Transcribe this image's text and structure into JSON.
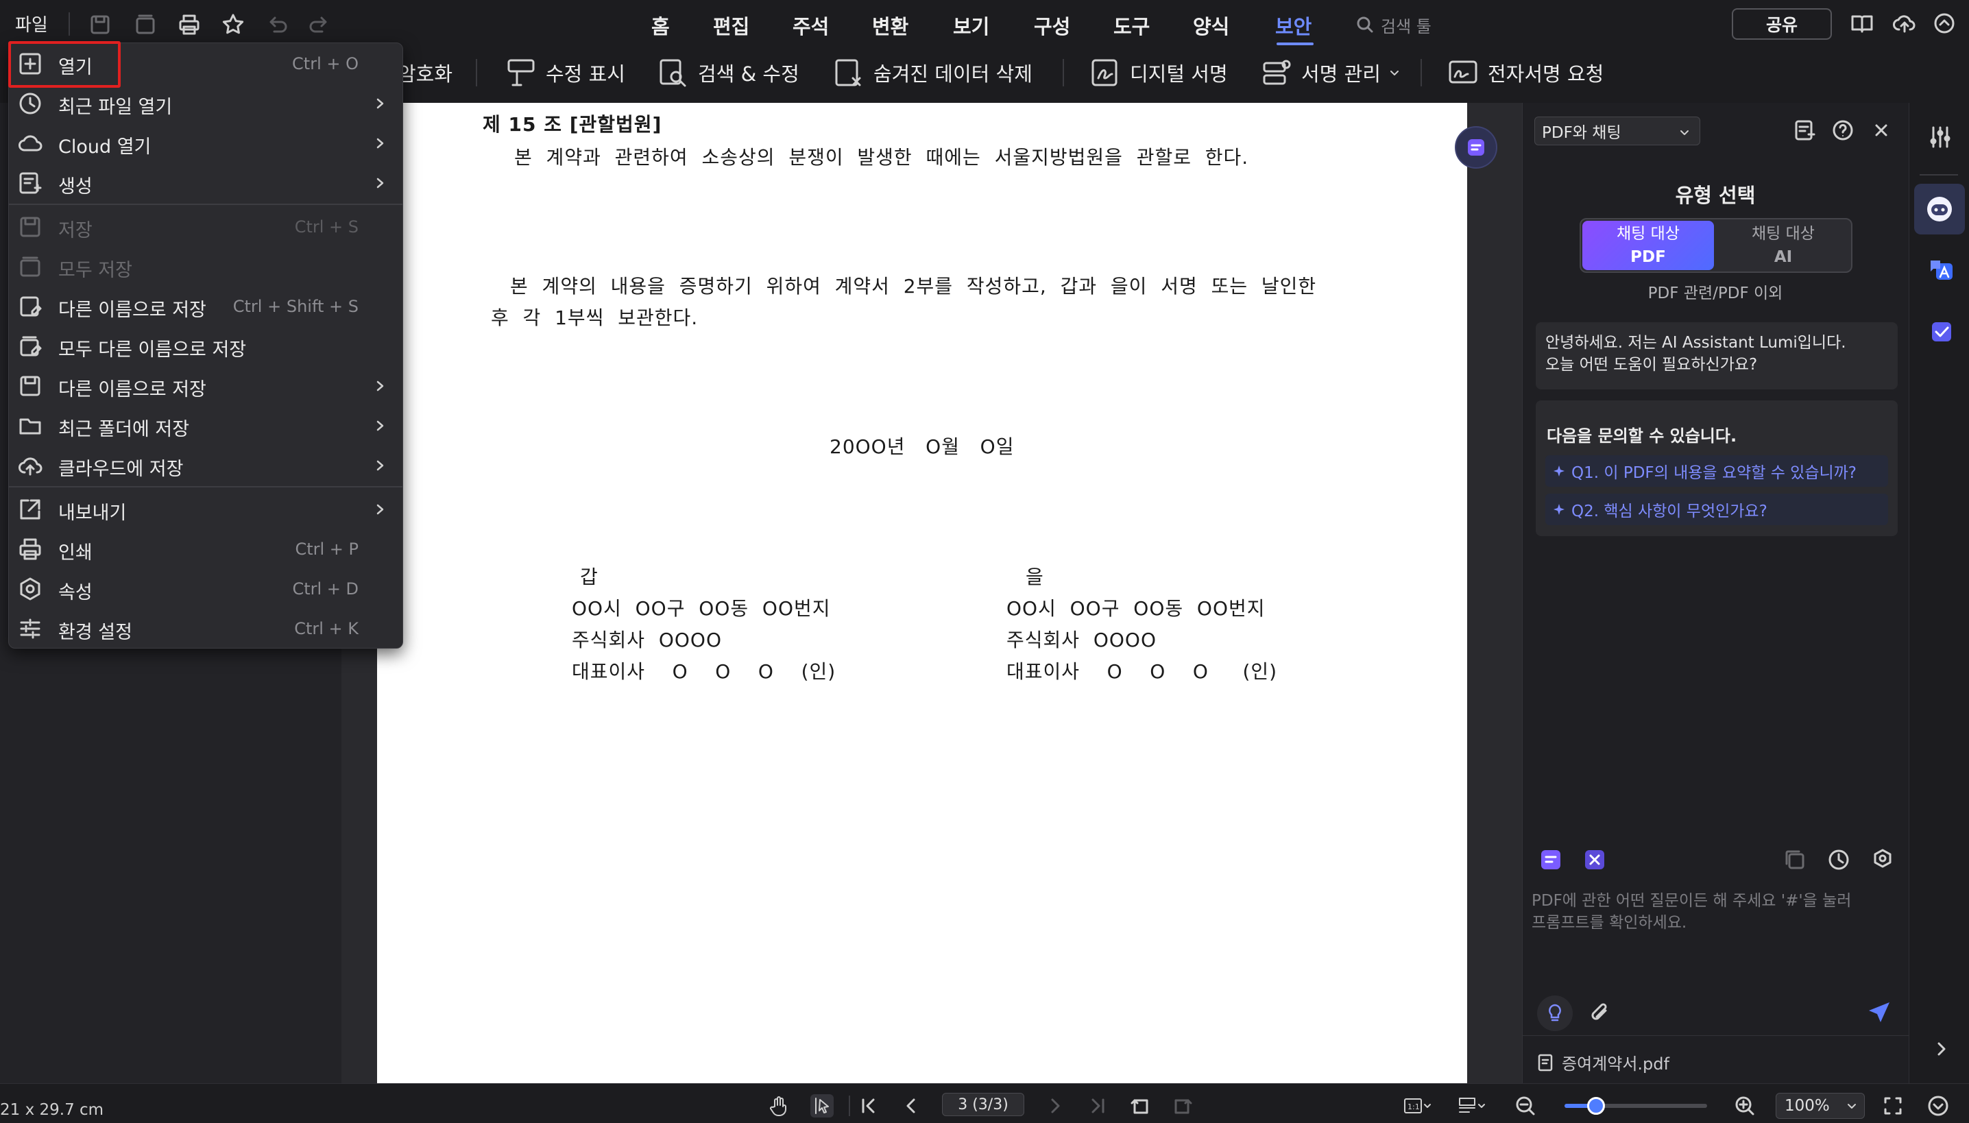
{
  "menubar": {
    "file": "파일",
    "tabs": [
      "홈",
      "편집",
      "주석",
      "변환",
      "보기",
      "구성",
      "도구",
      "양식",
      "보안"
    ],
    "active_tab": "보안",
    "search_placeholder": "검색 툴",
    "share": "공유"
  },
  "toolbar": {
    "items": [
      {
        "label": "암호화",
        "icon": "lock-icon"
      },
      {
        "label": "수정 표시",
        "icon": "redact-mark-icon"
      },
      {
        "label": "검색 & 수정",
        "icon": "search-redact-icon"
      },
      {
        "label": "숨겨진 데이터 삭제",
        "icon": "remove-hidden-data-icon"
      },
      {
        "label": "디지털 서명",
        "icon": "digital-signature-icon"
      },
      {
        "label": "서명 관리",
        "icon": "manage-signature-icon"
      },
      {
        "label": "전자서명 요청",
        "icon": "esign-request-icon"
      }
    ]
  },
  "file_menu": {
    "items": [
      {
        "label": "열기",
        "shortcut": "Ctrl + O",
        "icon": "plus-box-icon",
        "submenu": false,
        "disabled": false,
        "highlighted": true
      },
      {
        "label": "최근 파일 열기",
        "shortcut": "",
        "icon": "clock-icon",
        "submenu": true,
        "disabled": false
      },
      {
        "label": "Cloud 열기",
        "shortcut": "",
        "icon": "cloud-icon",
        "submenu": true,
        "disabled": false
      },
      {
        "label": "생성",
        "shortcut": "",
        "icon": "create-file-icon",
        "submenu": true,
        "disabled": false
      },
      {
        "label": "저장",
        "shortcut": "Ctrl + S",
        "icon": "save-icon",
        "submenu": false,
        "disabled": true
      },
      {
        "label": "모두 저장",
        "shortcut": "",
        "icon": "save-all-icon",
        "submenu": false,
        "disabled": true
      },
      {
        "label": "다른 이름으로 저장",
        "shortcut": "Ctrl + Shift + S",
        "icon": "save-as-icon",
        "submenu": false,
        "disabled": false
      },
      {
        "label": "모두 다른 이름으로 저장",
        "shortcut": "",
        "icon": "save-all-as-icon",
        "submenu": false,
        "disabled": false
      },
      {
        "label": "다른 이름으로 저장",
        "shortcut": "",
        "icon": "save-as-format-icon",
        "submenu": true,
        "disabled": false
      },
      {
        "label": "최근 폴더에 저장",
        "shortcut": "",
        "icon": "folder-icon",
        "submenu": true,
        "disabled": false
      },
      {
        "label": "클라우드에 저장",
        "shortcut": "",
        "icon": "cloud-upload-icon",
        "submenu": true,
        "disabled": false
      },
      {
        "label": "내보내기",
        "shortcut": "",
        "icon": "export-icon",
        "submenu": true,
        "disabled": false
      },
      {
        "label": "인쇄",
        "shortcut": "Ctrl + P",
        "icon": "print-icon",
        "submenu": false,
        "disabled": false
      },
      {
        "label": "속성",
        "shortcut": "Ctrl + D",
        "icon": "properties-icon",
        "submenu": false,
        "disabled": false
      },
      {
        "label": "환경 설정",
        "shortcut": "Ctrl + K",
        "icon": "settings-sliders-icon",
        "submenu": false,
        "disabled": false
      }
    ]
  },
  "document": {
    "article_title": "제 15 조 [관할법원]",
    "article_body": "본  계약과  관련하여  소송상의  분쟁이  발생한  때에는  서울지방법원을  관할로  한다.",
    "closing_line1": "본  계약의  내용을  증명하기  위하여  계약서  2부를  작성하고,  갑과  을이  서명  또는  날인한",
    "closing_line2": "후  각  1부씩  보관한다.",
    "date": "20OO년   O월   O일",
    "party_a": {
      "label": "갑",
      "address": "OO시  OO구  OO동  OO번지",
      "company": "주식회사  OOOO",
      "rep": "대표이사    O    O    O    (인)"
    },
    "party_b": {
      "label": "을",
      "address": "OO시  OO구  OO동  OO번지",
      "company": "주식회사  OOOO",
      "rep": "대표이사    O    O    O     (인)"
    }
  },
  "ai_panel": {
    "mode_select": "PDF와 채팅",
    "type_title": "유형 선택",
    "seg_pdf_line1": "채팅 대상",
    "seg_pdf_line2": "PDF",
    "seg_ai_line1": "채팅 대상",
    "seg_ai_line2": "AI",
    "seg_sub": "PDF 관련/PDF 이외",
    "greeting_line1": "안녕하세요. 저는 AI Assistant Lumi입니다.",
    "greeting_line2": "오늘 어떤 도움이 필요하신가요?",
    "suggest_title": "다음을 문의할 수 있습니다.",
    "q1": "Q1. 이 PDF의 내용을 요약할 수 있습니까?",
    "q2": "Q2. 핵심 사항이 무엇인가요?",
    "prompt_placeholder_line1": "PDF에 관한 어떤 질문이든 해 주세요 '#'을 눌러",
    "prompt_placeholder_line2": "프롬프트를 확인하세요.",
    "doc_name": "증여계약서.pdf",
    "accent": "#7a5cff"
  },
  "statusbar": {
    "page_size": "21 x 29.7 cm",
    "page_indicator": "3 (3/3)",
    "zoom": "100%",
    "zoom_fraction": 0.22
  }
}
